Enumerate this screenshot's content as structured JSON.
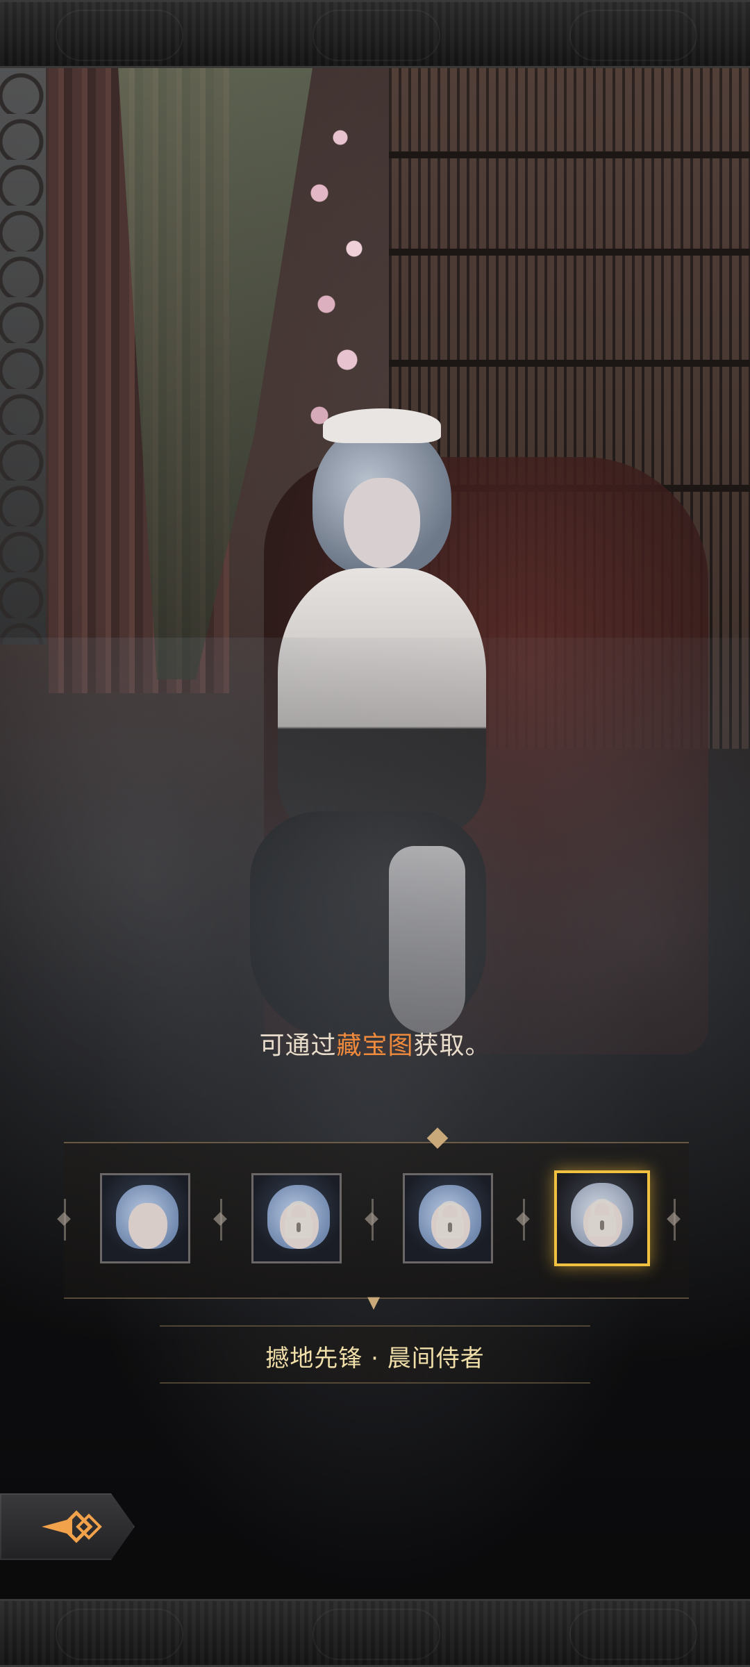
{
  "acquisition": {
    "prefix": "可通过",
    "highlight": "藏宝图",
    "suffix": "获取。"
  },
  "skin_selector": {
    "selected_index": 3,
    "items": [
      {
        "name": "portrait-1",
        "locked": false
      },
      {
        "name": "portrait-2",
        "locked": true
      },
      {
        "name": "portrait-3",
        "locked": true
      },
      {
        "name": "portrait-4",
        "locked": true
      }
    ]
  },
  "skin_name": "撼地先锋 · 晨间侍者",
  "colors": {
    "highlight": "#f08a3c",
    "selected_border": "#f0c040",
    "name_text": "#f1dfa9"
  },
  "icons": {
    "back": "back-arrow-icon",
    "lock": "lock-icon"
  }
}
